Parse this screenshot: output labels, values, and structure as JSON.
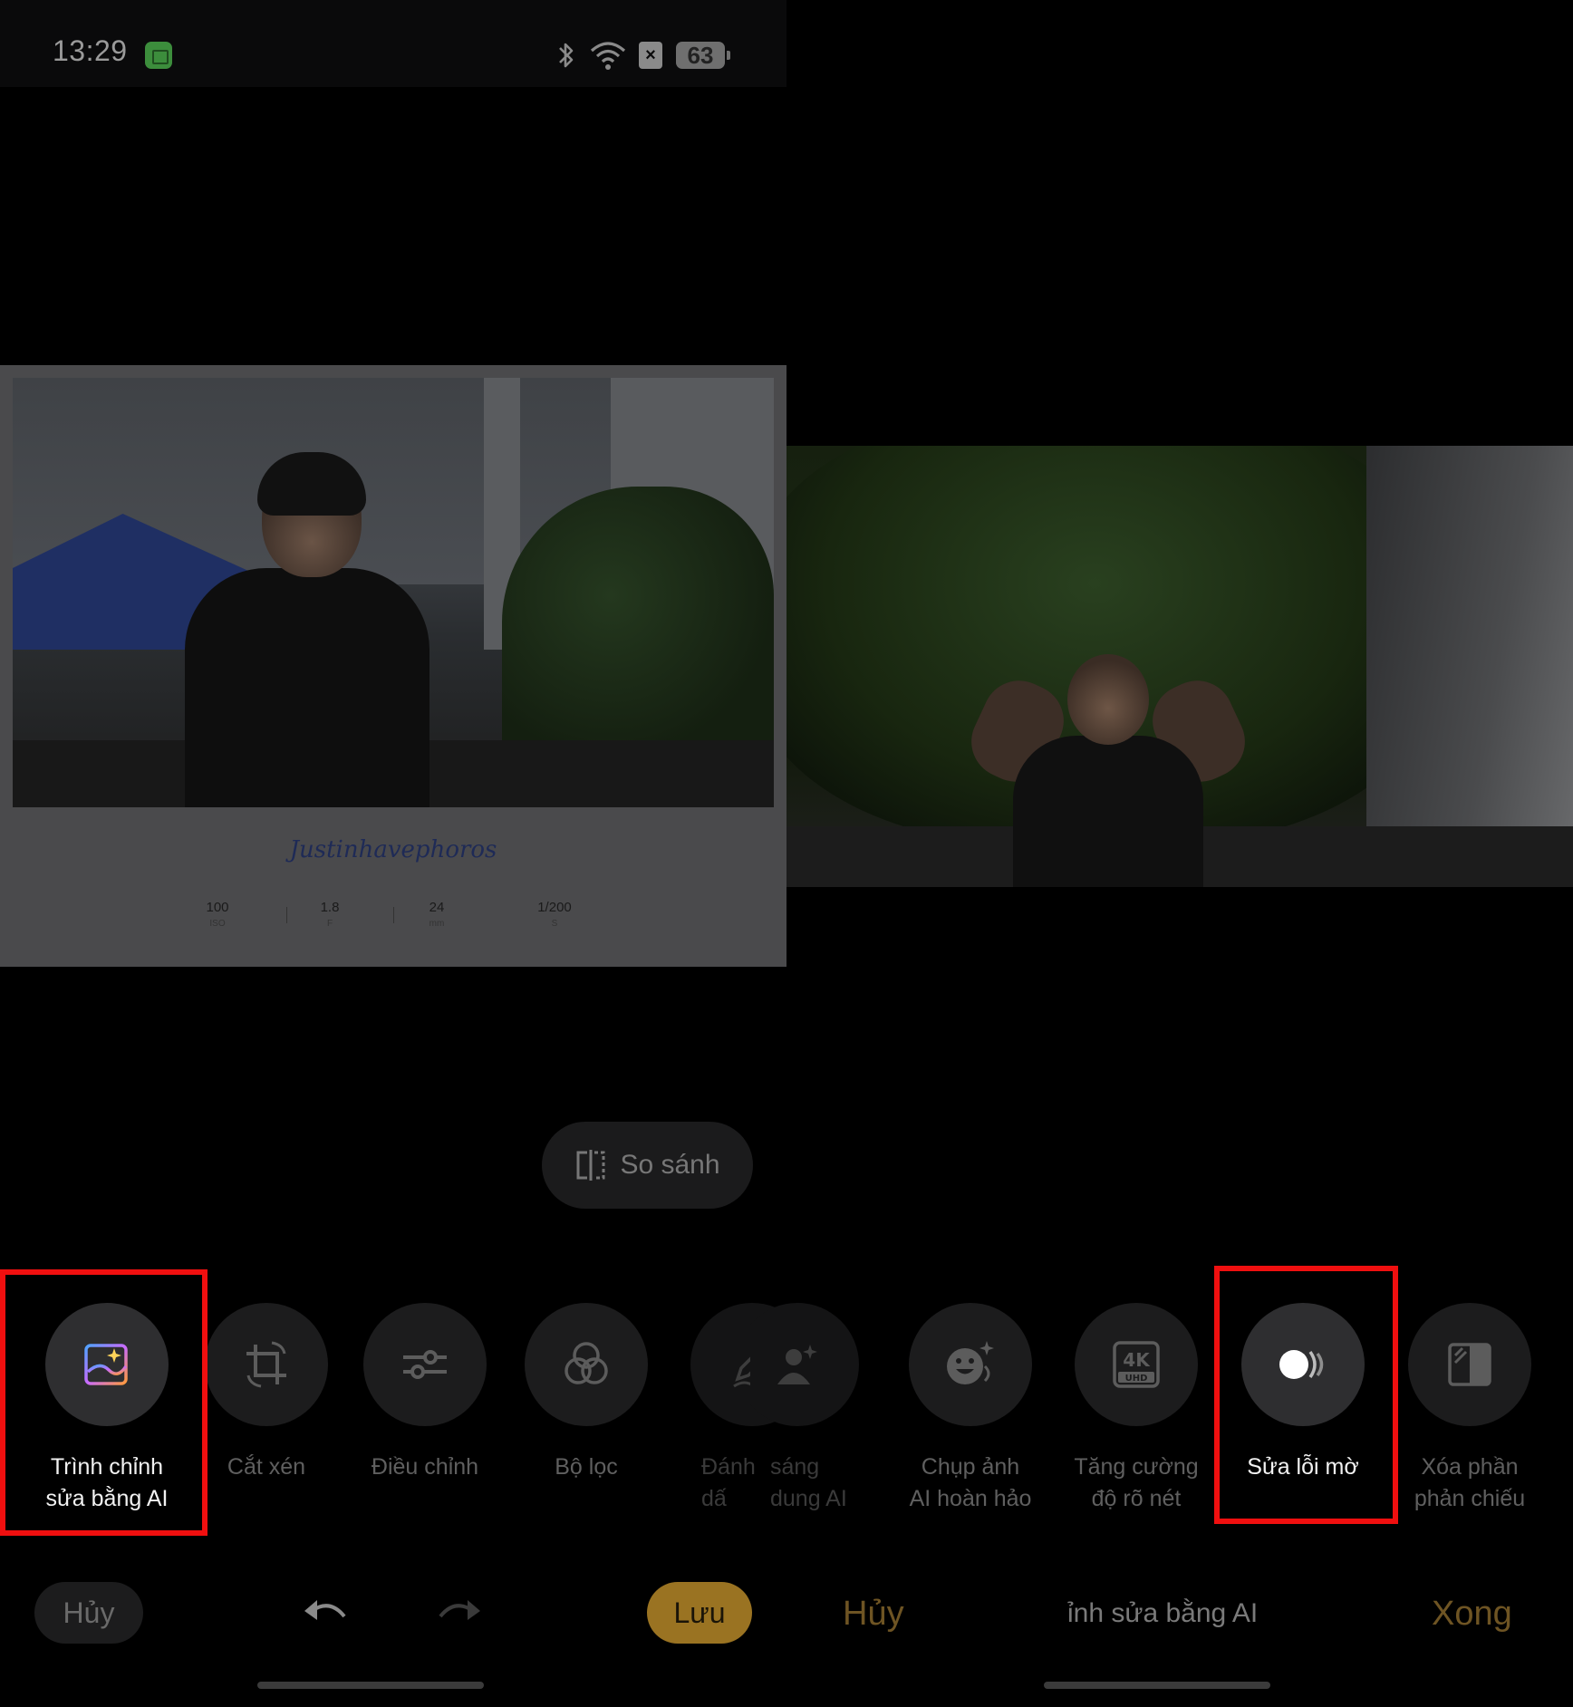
{
  "status_bar": {
    "time": "13:29",
    "battery": "63"
  },
  "left_photo": {
    "signature": "Justinhavephoros",
    "exif": [
      {
        "value": "100",
        "unit": "ISO"
      },
      {
        "value": "1.8",
        "unit": "F"
      },
      {
        "value": "24",
        "unit": "mm"
      },
      {
        "value": "1/200",
        "unit": "S"
      }
    ]
  },
  "compare": {
    "label": "So sánh"
  },
  "tools": [
    {
      "id": "ai-editor",
      "label_1": "Trình chỉnh",
      "label_2": "sửa bằng AI"
    },
    {
      "id": "crop",
      "label_1": "Cắt xén",
      "label_2": ""
    },
    {
      "id": "adjust",
      "label_1": "Điều chỉnh",
      "label_2": ""
    },
    {
      "id": "filter",
      "label_1": "Bộ lọc",
      "label_2": ""
    },
    {
      "id": "markup",
      "label_1": "Đánh dấ",
      "label_2": ""
    },
    {
      "id": "ai-light",
      "label_1": "sáng",
      "label_2": "dung AI"
    },
    {
      "id": "ai-perfect",
      "label_1": "Chụp ảnh",
      "label_2": "AI hoàn hảo"
    },
    {
      "id": "sharpen",
      "label_1": "Tăng cường",
      "label_2": "độ rõ nét"
    },
    {
      "id": "deblur",
      "label_1": "Sửa lỗi mờ",
      "label_2": ""
    },
    {
      "id": "reflection",
      "label_1": "Xóa phần",
      "label_2": "phản chiếu"
    }
  ],
  "bottom_bar": {
    "cancel_left": "Hủy",
    "save": "Lưu",
    "cancel_right": "Hủy",
    "mode_title": "ỉnh sửa bằng AI",
    "done": "Xong"
  },
  "colors": {
    "accent": "#9a7322",
    "highlight": "#f00f0f",
    "active_label": "#f2f2f2"
  }
}
